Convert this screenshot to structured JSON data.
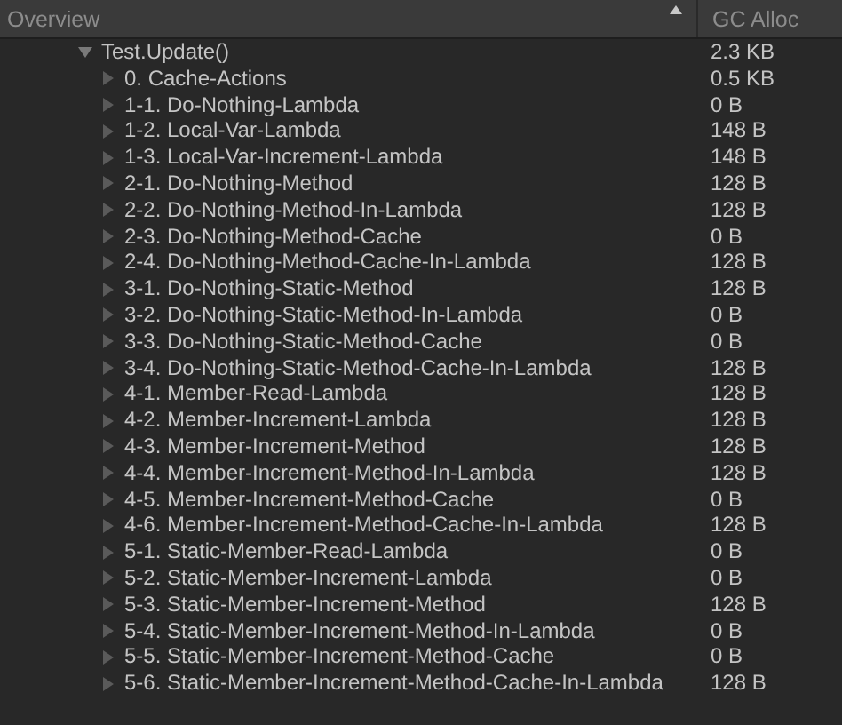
{
  "table": {
    "columns": [
      {
        "label": "Overview",
        "sorted": true
      },
      {
        "label": "GC Alloc",
        "sorted": false
      }
    ],
    "rows": [
      {
        "name": "Test.Update()",
        "alloc": "2.3 KB",
        "expanded": true,
        "children": [
          {
            "name": "0. Cache-Actions",
            "alloc": "0.5 KB",
            "expanded": false
          },
          {
            "name": "1-1. Do-Nothing-Lambda",
            "alloc": "0 B",
            "expanded": false
          },
          {
            "name": "1-2. Local-Var-Lambda",
            "alloc": "148 B",
            "expanded": false
          },
          {
            "name": "1-3. Local-Var-Increment-Lambda",
            "alloc": "148 B",
            "expanded": false
          },
          {
            "name": "2-1. Do-Nothing-Method",
            "alloc": "128 B",
            "expanded": false
          },
          {
            "name": "2-2. Do-Nothing-Method-In-Lambda",
            "alloc": "128 B",
            "expanded": false
          },
          {
            "name": "2-3. Do-Nothing-Method-Cache",
            "alloc": "0 B",
            "expanded": false
          },
          {
            "name": "2-4. Do-Nothing-Method-Cache-In-Lambda",
            "alloc": "128 B",
            "expanded": false
          },
          {
            "name": "3-1. Do-Nothing-Static-Method",
            "alloc": "128 B",
            "expanded": false
          },
          {
            "name": "3-2. Do-Nothing-Static-Method-In-Lambda",
            "alloc": "0 B",
            "expanded": false
          },
          {
            "name": "3-3. Do-Nothing-Static-Method-Cache",
            "alloc": "0 B",
            "expanded": false
          },
          {
            "name": "3-4. Do-Nothing-Static-Method-Cache-In-Lambda",
            "alloc": "128 B",
            "expanded": false
          },
          {
            "name": "4-1. Member-Read-Lambda",
            "alloc": "128 B",
            "expanded": false
          },
          {
            "name": "4-2. Member-Increment-Lambda",
            "alloc": "128 B",
            "expanded": false
          },
          {
            "name": "4-3. Member-Increment-Method",
            "alloc": "128 B",
            "expanded": false
          },
          {
            "name": "4-4. Member-Increment-Method-In-Lambda",
            "alloc": "128 B",
            "expanded": false
          },
          {
            "name": "4-5. Member-Increment-Method-Cache",
            "alloc": "0 B",
            "expanded": false
          },
          {
            "name": "4-6. Member-Increment-Method-Cache-In-Lambda",
            "alloc": "128 B",
            "expanded": false
          },
          {
            "name": "5-1. Static-Member-Read-Lambda",
            "alloc": "0 B",
            "expanded": false
          },
          {
            "name": "5-2. Static-Member-Increment-Lambda",
            "alloc": "0 B",
            "expanded": false
          },
          {
            "name": "5-3. Static-Member-Increment-Method",
            "alloc": "128 B",
            "expanded": false
          },
          {
            "name": "5-4. Static-Member-Increment-Method-In-Lambda",
            "alloc": "0 B",
            "expanded": false
          },
          {
            "name": "5-5. Static-Member-Increment-Method-Cache",
            "alloc": "0 B",
            "expanded": false
          },
          {
            "name": "5-6. Static-Member-Increment-Method-Cache-In-Lambda",
            "alloc": "128 B",
            "expanded": false
          }
        ]
      }
    ]
  }
}
